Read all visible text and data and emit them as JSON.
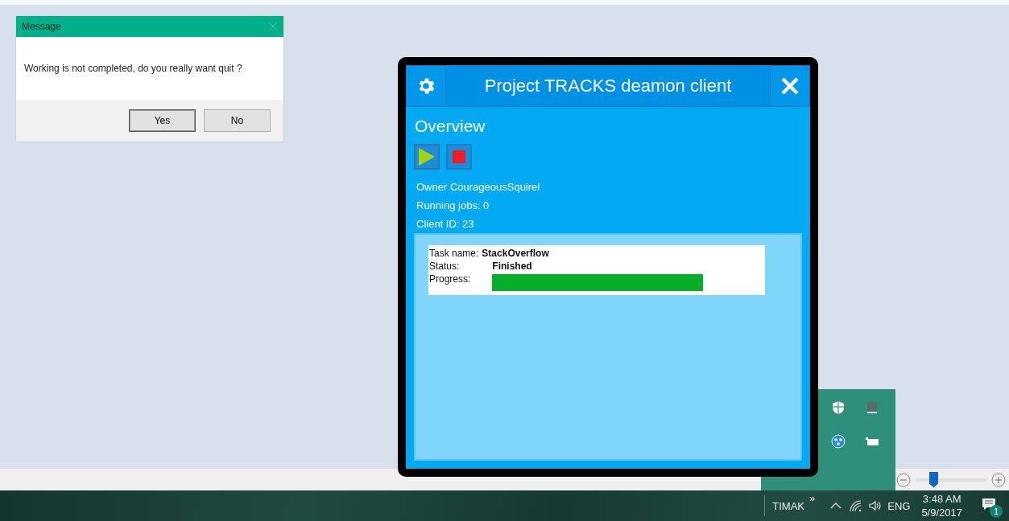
{
  "message_dialog": {
    "title": "Message",
    "text": "Working is not completed, do you really want quit ?",
    "buttons": [
      {
        "label": "Yes",
        "selected": true
      },
      {
        "label": "No",
        "selected": false
      }
    ]
  },
  "client_window": {
    "title": "Project TRACKS deamon client",
    "heading": "Overview",
    "controls": [
      {
        "kind": "play",
        "selected": true
      },
      {
        "kind": "stop",
        "selected": false
      }
    ],
    "info": [
      "Owner CourageousSquirel",
      "Running jobs: 0",
      "Client ID: 23"
    ],
    "tasks": [
      {
        "name_label": "Task name:",
        "name": "StackOverflow",
        "status_label": "Status:",
        "status": "Finished",
        "progress_label": "Progress:"
      }
    ]
  },
  "zoom_slider": {
    "level": 0.25
  },
  "taskbar": {
    "toolbar": "TIMAK",
    "toolbar_chevron": "»",
    "language": "ENG",
    "time": "3:48 AM",
    "date": "5/9/2017",
    "notification_count": "1"
  }
}
